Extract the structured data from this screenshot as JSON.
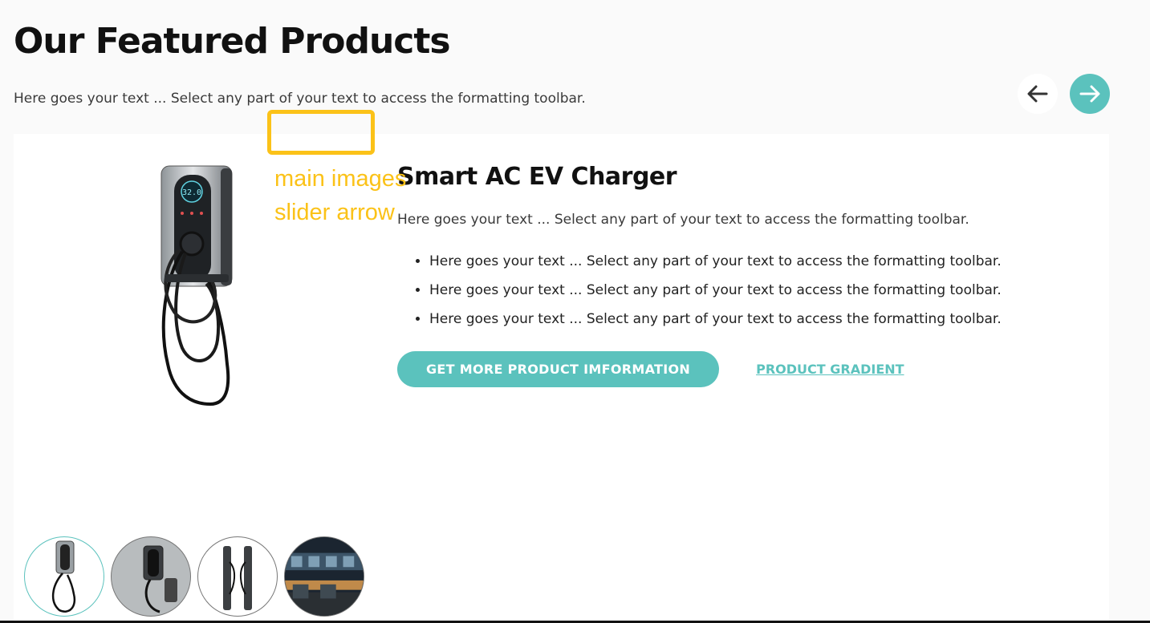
{
  "header": {
    "title": "Our Featured Products",
    "subtitle": "Here goes your text ... Select any part of your text to access the formatting toolbar."
  },
  "slider_nav": {
    "prev_icon": "arrow-left-icon",
    "next_icon": "arrow-right-icon"
  },
  "product": {
    "title": "Smart AC EV Charger",
    "description": "Here goes your text ... Select any part of your text to access the formatting toolbar.",
    "features": [
      "Here goes your text ... Select any part of your text to access the formatting toolbar.",
      "Here goes your text ... Select any part of your text to access the formatting toolbar.",
      "Here goes your text ... Select any part of your text to access the formatting toolbar."
    ],
    "cta_label": "GET MORE PRODUCT IMFORMATION",
    "link_label": "PRODUCT GRADIENT",
    "display_reading": "32.0"
  },
  "annotation": {
    "line1": "main images",
    "line2": "slider arrow"
  },
  "colors": {
    "accent": "#5bc2bd",
    "annotation": "#fbc218",
    "background": "#fafafa"
  }
}
